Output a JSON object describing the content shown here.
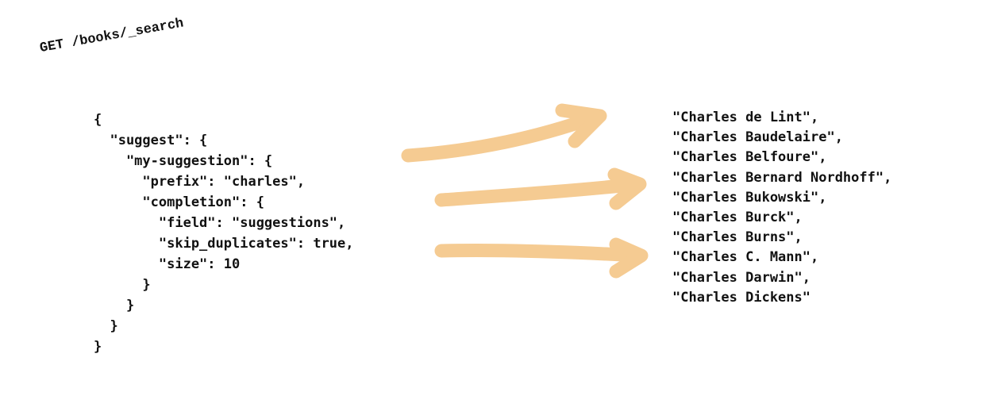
{
  "request": {
    "text": "GET /books/_search"
  },
  "query_lines": [
    "{",
    "  \"suggest\": {",
    "    \"my-suggestion\": {",
    "      \"prefix\": \"charles\",",
    "      \"completion\": {",
    "        \"field\": \"suggestions\",",
    "        \"skip_duplicates\": true,",
    "        \"size\": 10",
    "      }",
    "    }",
    "  }",
    "}"
  ],
  "results": [
    "\"Charles de Lint\",",
    "\"Charles Baudelaire\",",
    "\"Charles Belfoure\",",
    "\"Charles Bernard Nordhoff\",",
    "\"Charles Bukowski\",",
    "\"Charles Burck\",",
    "\"Charles Burns\",",
    "\"Charles C. Mann\",",
    "\"Charles Darwin\",",
    "\"Charles Dickens\""
  ],
  "colors": {
    "arrow": "#f5cb92",
    "text": "#111111",
    "background": "#ffffff"
  }
}
